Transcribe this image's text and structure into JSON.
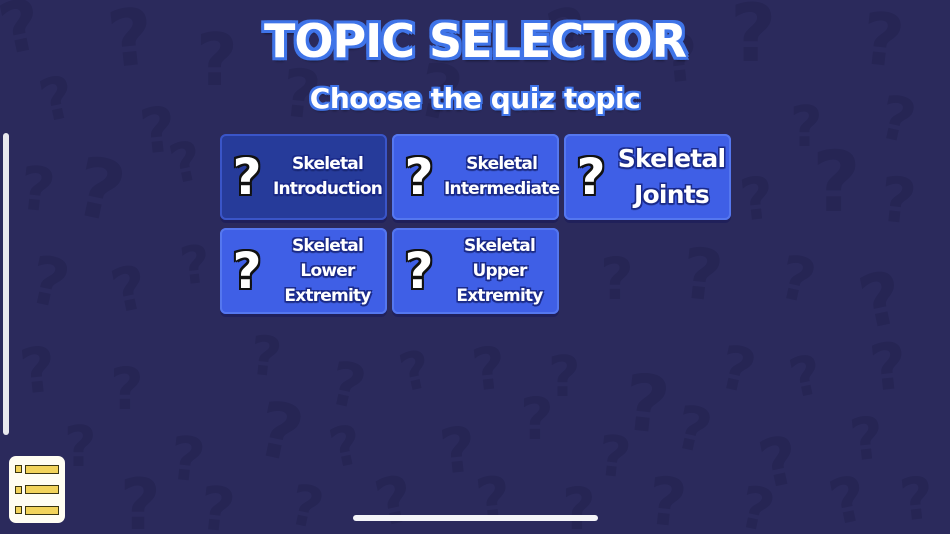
{
  "header": {
    "title": "TOPIC SELECTOR",
    "subtitle": "Choose the quiz topic"
  },
  "topics": [
    {
      "icon": "question-mark-icon",
      "icon_glyph": "?",
      "label": "Skeletal\nIntroduction",
      "selected": true
    },
    {
      "icon": "question-mark-icon",
      "icon_glyph": "?",
      "label": "Skeletal\nIntermediate",
      "selected": false
    },
    {
      "icon": "question-mark-icon",
      "icon_glyph": "?",
      "label": "Skeletal\nJoints",
      "selected": false
    },
    {
      "icon": "question-mark-icon",
      "icon_glyph": "?",
      "label": "Skeletal\nLower\nExtremity",
      "selected": false
    },
    {
      "icon": "question-mark-icon",
      "icon_glyph": "?",
      "label": "Skeletal\nUpper\nExtremity",
      "selected": false
    }
  ],
  "menu_button": {
    "icon": "list-menu-icon"
  },
  "colors": {
    "background": "#2b2a5c",
    "background_pattern": "#262554",
    "card": "#3f5fe6",
    "card_selected": "#263b9a",
    "title_outline": "#3f74e8",
    "menu_button": "#fffdf2",
    "menu_accent": "#f2d35a"
  }
}
